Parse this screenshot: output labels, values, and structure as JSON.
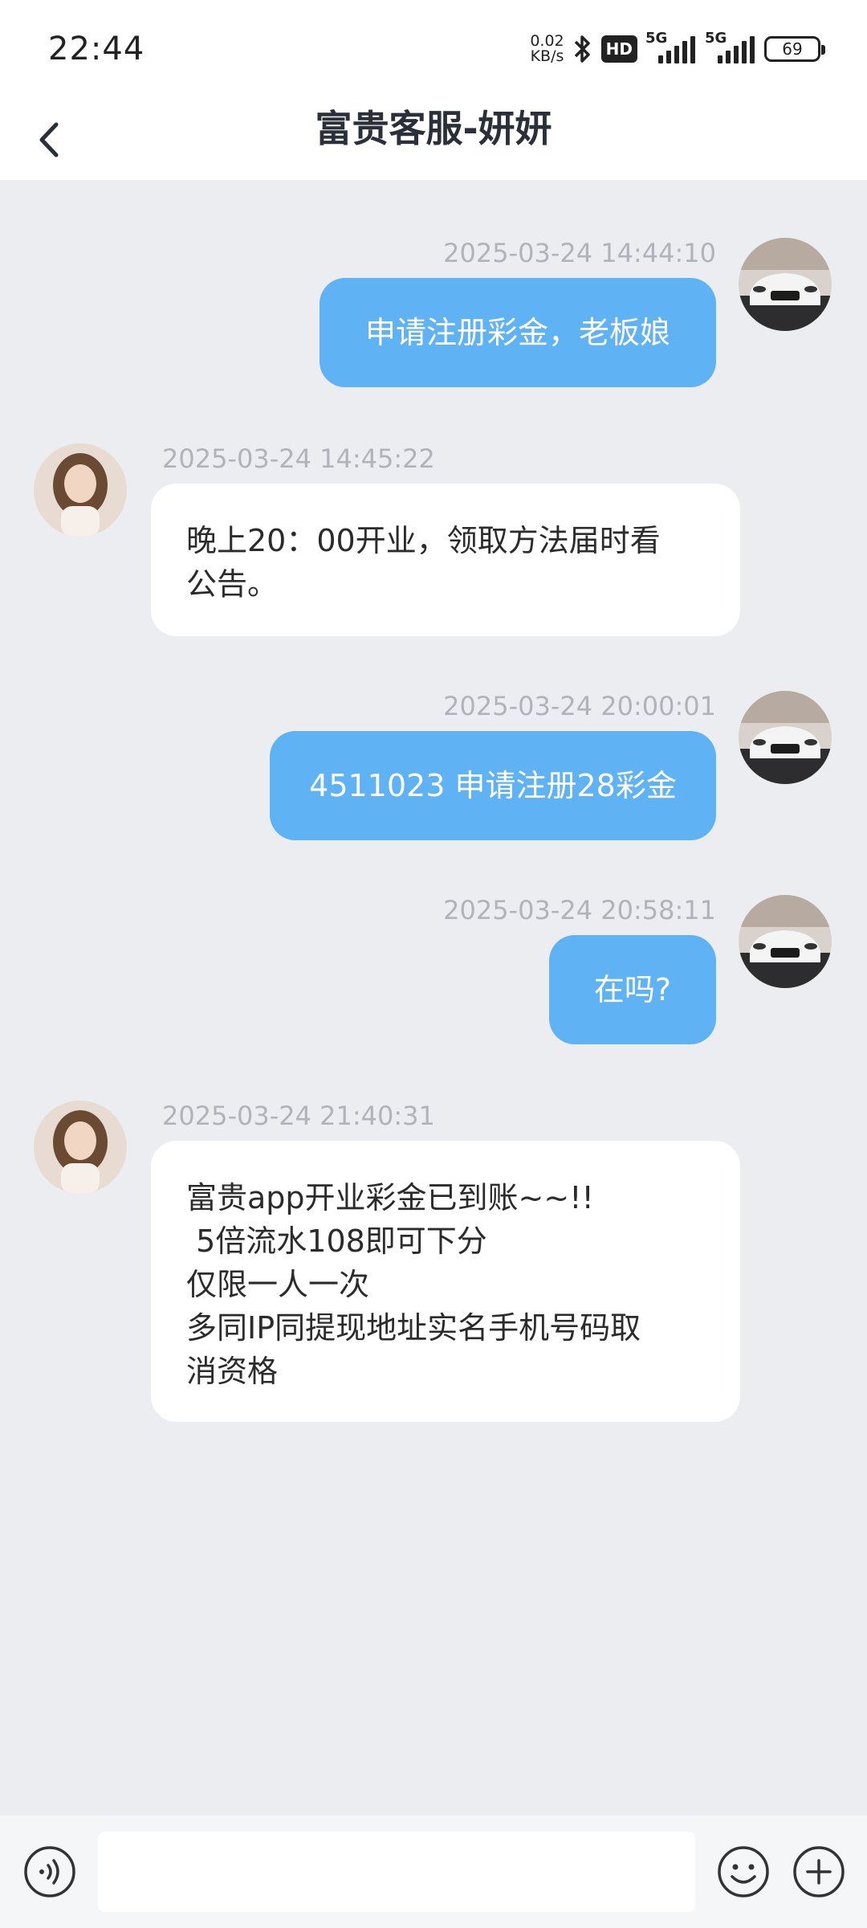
{
  "status_bar": {
    "time": "22:44",
    "net_speed_value": "0.02",
    "net_speed_unit": "KB/s",
    "hd_label": "HD",
    "signal_1_label": "5G",
    "signal_2_label": "5G",
    "battery": "69"
  },
  "header": {
    "title": "富贵客服-妍妍",
    "back_icon": "chevron-left-icon"
  },
  "messages": [
    {
      "direction": "out",
      "timestamp": "2025-03-24 14:44:10",
      "text": "申请注册彩金，老板娘"
    },
    {
      "direction": "in",
      "timestamp": "2025-03-24 14:45:22",
      "text": "晚上20：00开业，领取方法届时看\n公告。"
    },
    {
      "direction": "out",
      "timestamp": "2025-03-24 20:00:01",
      "text": "4511023 申请注册28彩金"
    },
    {
      "direction": "out",
      "timestamp": "2025-03-24 20:58:11",
      "text": "在吗?"
    },
    {
      "direction": "in",
      "timestamp": "2025-03-24 21:40:31",
      "text": "富贵app开业彩金已到账~~!!\n 5倍流水108即可下分\n仅限一人一次\n多同IP同提现地址实名手机号码取\n消资格"
    }
  ],
  "input_bar": {
    "value": "",
    "placeholder": "",
    "voice_icon": "voice-icon",
    "emoji_icon": "emoji-icon",
    "add_icon": "plus-icon"
  },
  "colors": {
    "outgoing_bubble": "#5fb2f4",
    "incoming_bubble": "#ffffff",
    "chat_background": "#ebedf1"
  }
}
